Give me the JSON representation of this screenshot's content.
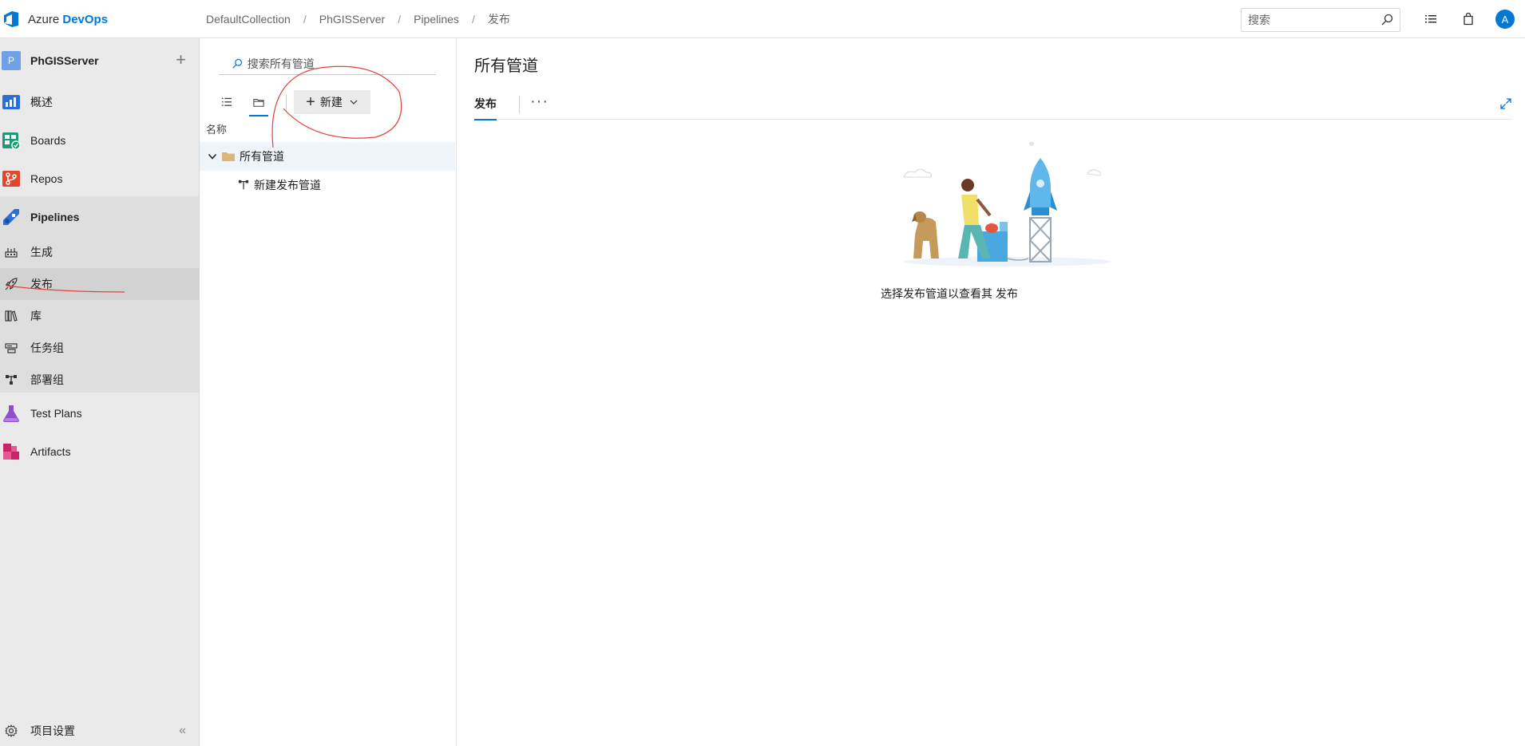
{
  "app": {
    "brand_prefix": "Azure",
    "brand_accent": "DevOps",
    "accent_color": "#0078d4"
  },
  "breadcrumb": [
    "DefaultCollection",
    "PhGISServer",
    "Pipelines",
    "发布"
  ],
  "header": {
    "search_placeholder": "搜索",
    "avatar_initial": "A",
    "icons": [
      "list-icon",
      "shopping-bag-icon"
    ]
  },
  "sidebar": {
    "project_badge": "P",
    "project_name": "PhGISServer",
    "add_icon": "plus-icon",
    "items": [
      {
        "label": "概述",
        "icon": "overview-icon"
      },
      {
        "label": "Boards",
        "icon": "boards-icon"
      },
      {
        "label": "Repos",
        "icon": "repos-icon"
      },
      {
        "label": "Pipelines",
        "icon": "pipelines-icon"
      },
      {
        "label": "生成",
        "icon": "build-icon"
      },
      {
        "label": "发布",
        "icon": "rocket-icon"
      },
      {
        "label": "库",
        "icon": "library-icon"
      },
      {
        "label": "任务组",
        "icon": "task-group-icon"
      },
      {
        "label": "部署组",
        "icon": "deployment-group-icon"
      },
      {
        "label": "Test Plans",
        "icon": "test-plans-icon"
      },
      {
        "label": "Artifacts",
        "icon": "artifacts-icon"
      }
    ],
    "settings_label": "项目设置",
    "collapse_glyph": "«"
  },
  "pipelines_panel": {
    "search_placeholder": "搜索所有管道",
    "new_button": "新建",
    "column_header": "名称",
    "tree": [
      {
        "label": "所有管道",
        "type": "folder"
      },
      {
        "label": "新建发布管道",
        "type": "pipeline"
      }
    ]
  },
  "content": {
    "title": "所有管道",
    "tab": "发布",
    "more_glyph": "···",
    "empty_message": "选择发布管道以查看其 发布"
  }
}
